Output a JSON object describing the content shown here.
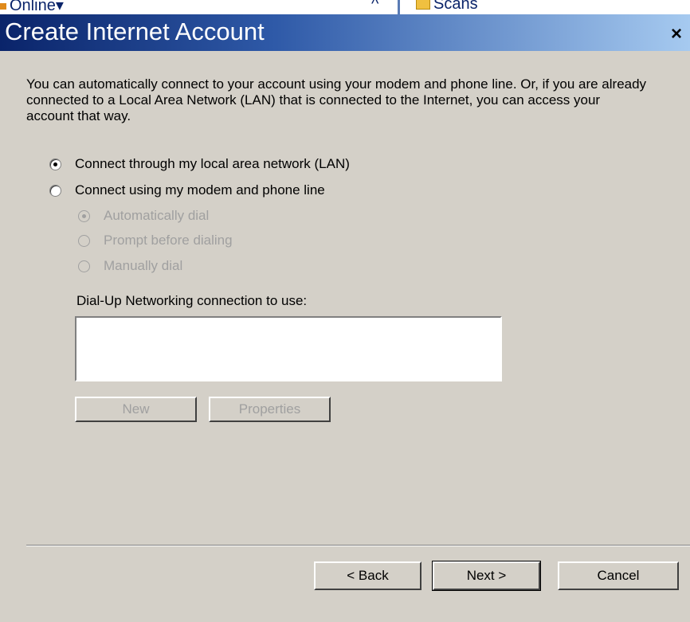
{
  "background": {
    "online_label": "Online",
    "scans_label": "Scans"
  },
  "dialog": {
    "title": "Create Internet Account",
    "close_glyph": "×",
    "intro": "You can automatically connect to your account using your modem and phone line.  Or, if you are already connected to a Local Area Network (LAN) that is connected to the Internet, you can access your account that way.",
    "options": [
      {
        "label": "Connect through my local area network (LAN)",
        "checked": true,
        "enabled": true
      },
      {
        "label": "Connect using my modem and phone line",
        "checked": false,
        "enabled": true
      }
    ],
    "dial_options": [
      {
        "label": "Automatically dial",
        "checked": true,
        "enabled": false
      },
      {
        "label": "Prompt before dialing",
        "checked": false,
        "enabled": false
      },
      {
        "label": "Manually dial",
        "checked": false,
        "enabled": false
      }
    ],
    "dialup_label": "Dial-Up Networking connection to use:",
    "new_label": "New",
    "properties_label": "Properties",
    "back_label": "< Back",
    "next_label": "Next >",
    "cancel_label": "Cancel"
  },
  "colors": {
    "dialog_bg": "#d4d0c8",
    "titlebar_start": "#0a246a",
    "titlebar_end": "#a6caf0",
    "disabled_text": "#a0a0a0"
  }
}
